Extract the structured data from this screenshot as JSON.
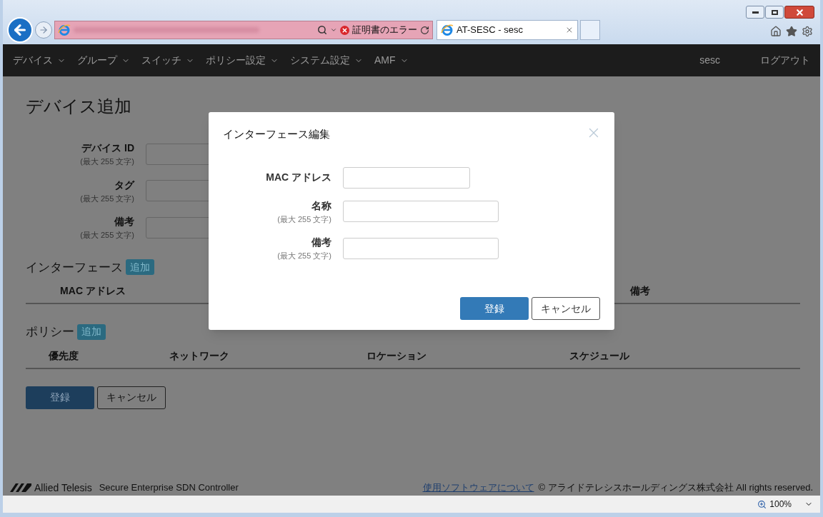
{
  "browser": {
    "address_bar": {
      "status": "証明書のエラー"
    },
    "tabs": [
      {
        "label": "AT-SESC - sesc",
        "selected": true
      }
    ],
    "zoom": "100%"
  },
  "nav": {
    "menus": [
      {
        "label": "デバイス"
      },
      {
        "label": "グループ"
      },
      {
        "label": "スイッチ"
      },
      {
        "label": "ポリシー設定"
      },
      {
        "label": "システム設定"
      },
      {
        "label": "AMF"
      }
    ],
    "user": "sesc",
    "logout": "ログアウト"
  },
  "page": {
    "title": "デバイス追加",
    "fields": [
      {
        "label": "デバイス ID",
        "hint": "(最大 255 文字)"
      },
      {
        "label": "タグ",
        "hint": "(最大 255 文字)"
      },
      {
        "label": "備考",
        "hint": "(最大 255 文字)"
      }
    ],
    "sections": [
      {
        "title": "インターフェース",
        "add": "追加",
        "columns": [
          "MAC アドレス",
          "備考"
        ]
      },
      {
        "title": "ポリシー",
        "add": "追加",
        "columns": [
          "優先度",
          "ネットワーク",
          "ロケーション",
          "スケジュール"
        ]
      }
    ],
    "buttons": {
      "submit": "登録",
      "cancel": "キャンセル"
    }
  },
  "dialog": {
    "title": "インターフェース編集",
    "fields": [
      {
        "label": "MAC アドレス",
        "kind": "short"
      },
      {
        "label": "名称",
        "hint": "(最大 255 文字)",
        "kind": "long"
      },
      {
        "label": "備考",
        "hint": "(最大 255 文字)",
        "kind": "long"
      }
    ],
    "buttons": {
      "submit": "登録",
      "cancel": "キャンセル"
    }
  },
  "footer": {
    "brand": "Allied Telesis",
    "product": "Secure Enterprise SDN Controller",
    "link": "使用ソフトウェアについて",
    "copyright": "© アライドテレシスホールディングス株式会社 All rights reserved."
  }
}
